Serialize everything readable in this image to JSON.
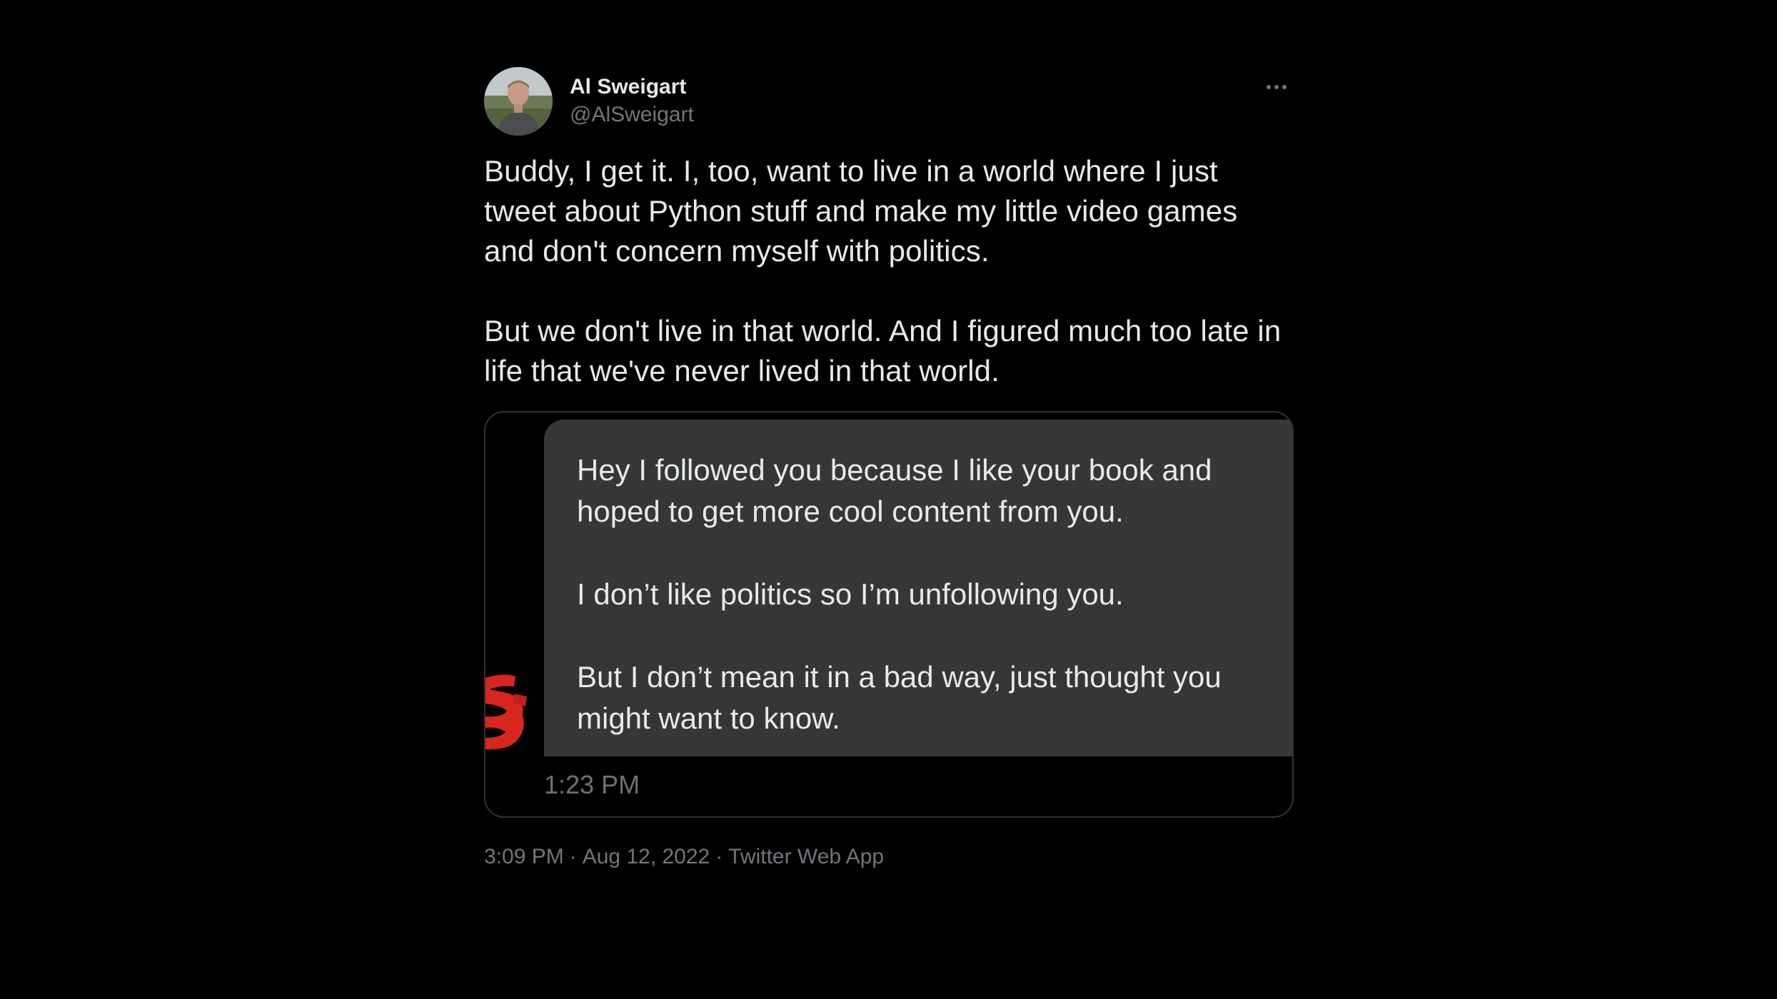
{
  "author": {
    "name": "Al Sweigart",
    "handle": "@AlSweigart"
  },
  "tweet": {
    "text": "Buddy, I get it. I, too, want to live in a world where I just tweet about Python stuff and make my little video games and don't concern myself with politics.\n\nBut we don't live in that world. And I figured much too late in life that we've never lived in that world."
  },
  "media": {
    "message_text": "Hey I followed you because I like your book and hoped to get more cool content from you.\n\nI don’t like politics so I’m unfollowing you.\n\nBut I don’t mean it in a bad way, just thought you might want to know.",
    "message_time": "1:23 PM"
  },
  "meta": {
    "time": "3:09 PM",
    "date": "Aug 12, 2022",
    "source": "Twitter Web App",
    "separator": "·"
  },
  "icons": {
    "more": "more-horizontal-icon",
    "avatar": "profile-photo"
  },
  "colors": {
    "background": "#000000",
    "primary_text": "#e7e9ea",
    "secondary_text": "#71767b",
    "bubble": "#343638",
    "redaction": "#d8261f"
  }
}
